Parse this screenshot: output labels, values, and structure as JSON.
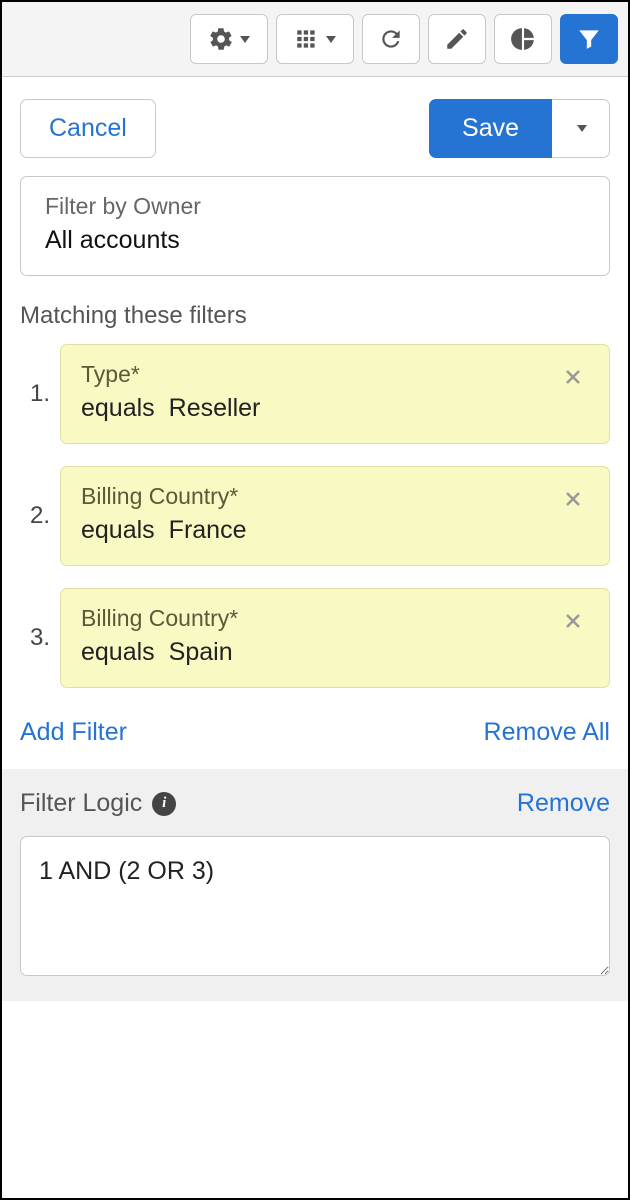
{
  "actions": {
    "cancel": "Cancel",
    "save": "Save"
  },
  "owner": {
    "label": "Filter by Owner",
    "value": "All accounts"
  },
  "filters_title": "Matching these filters",
  "filters": [
    {
      "num": "1.",
      "field": "Type*",
      "op": "equals",
      "val": "Reseller"
    },
    {
      "num": "2.",
      "field": "Billing Country*",
      "op": "equals",
      "val": "France"
    },
    {
      "num": "3.",
      "field": "Billing Country*",
      "op": "equals",
      "val": "Spain"
    }
  ],
  "filter_actions": {
    "add": "Add Filter",
    "remove_all": "Remove All"
  },
  "logic": {
    "title": "Filter Logic",
    "remove": "Remove",
    "value": "1 AND (2 OR 3)"
  }
}
